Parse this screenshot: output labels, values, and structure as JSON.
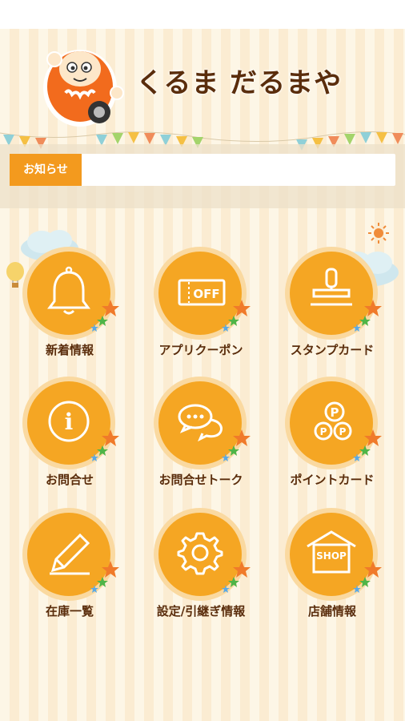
{
  "header": {
    "app_title": "くるま だるまや",
    "logo_icon": "daruma-car-mascot"
  },
  "notice": {
    "label": "お知らせ",
    "text": ""
  },
  "menu": [
    {
      "label": "新着情報",
      "icon": "bell-icon"
    },
    {
      "label": "アプリクーポン",
      "icon": "coupon-icon",
      "icon_text": "OFF"
    },
    {
      "label": "スタンプカード",
      "icon": "stamp-icon"
    },
    {
      "label": "お問合せ",
      "icon": "info-icon",
      "icon_text": "i"
    },
    {
      "label": "お問合せトーク",
      "icon": "chat-icon"
    },
    {
      "label": "ポイントカード",
      "icon": "points-icon",
      "icon_text": "P"
    },
    {
      "label": "在庫一覧",
      "icon": "pencil-icon"
    },
    {
      "label": "設定/引継ぎ情報",
      "icon": "gear-icon"
    },
    {
      "label": "店舗情報",
      "icon": "shop-icon",
      "icon_text": "SHOP"
    }
  ],
  "colors": {
    "accent": "#f5a623",
    "accent_light": "#fad9a0",
    "text_brown": "#5a2d0c",
    "notice_orange": "#f39a1e"
  }
}
